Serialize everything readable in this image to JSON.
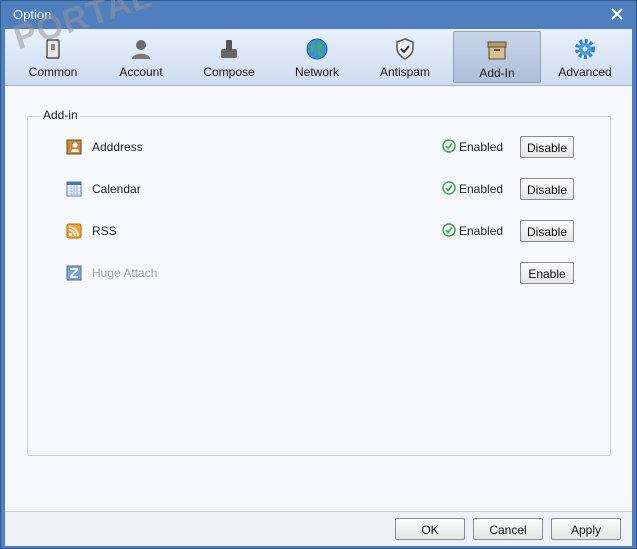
{
  "window": {
    "title": "Option"
  },
  "tabs": [
    {
      "label": "Common",
      "icon": "common-icon"
    },
    {
      "label": "Account",
      "icon": "account-icon"
    },
    {
      "label": "Compose",
      "icon": "compose-icon"
    },
    {
      "label": "Network",
      "icon": "network-globe-icon"
    },
    {
      "label": "Antispam",
      "icon": "shield-icon"
    },
    {
      "label": "Add-In",
      "icon": "box-icon",
      "selected": true
    },
    {
      "label": "Advanced",
      "icon": "gear-icon"
    }
  ],
  "group": {
    "label": "Add-in"
  },
  "addins": [
    {
      "name": "Adddress",
      "icon": "address-book-icon",
      "status": "Enabled",
      "button": "Disable"
    },
    {
      "name": "Calendar",
      "icon": "calendar-icon",
      "status": "Enabled",
      "button": "Disable"
    },
    {
      "name": "RSS",
      "icon": "rss-icon",
      "status": "Enabled",
      "button": "Disable"
    },
    {
      "name": "Huge Attach",
      "icon": "huge-attach-icon",
      "status": "",
      "button": "Enable"
    }
  ],
  "footer": {
    "ok": "OK",
    "cancel": "Cancel",
    "apply": "Apply"
  },
  "watermark": "PORTAL",
  "colors": {
    "titlebar": "#4f7fbf",
    "enabled_check": "#3aa14a",
    "selected_tab": "#b8c8de"
  }
}
